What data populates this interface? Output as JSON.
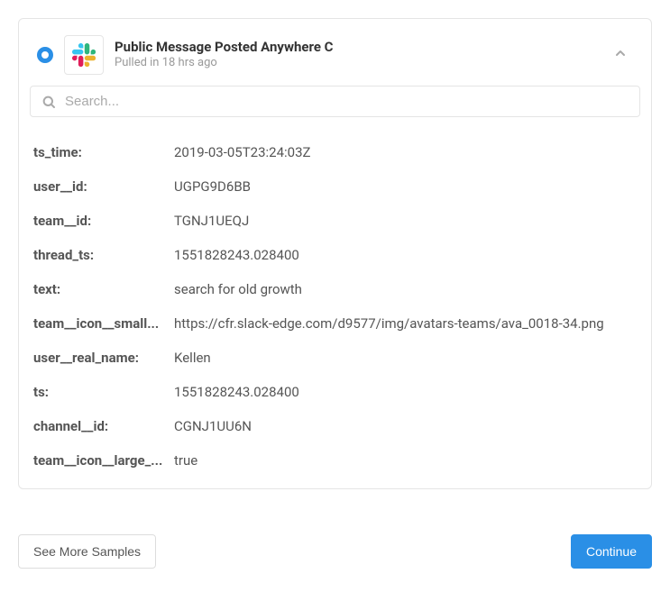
{
  "header": {
    "title": "Public Message Posted Anywhere C",
    "subtitle": "Pulled in 18 hrs ago"
  },
  "search": {
    "placeholder": "Search..."
  },
  "fields": [
    {
      "key": "ts_time:",
      "value": "2019-03-05T23:24:03Z"
    },
    {
      "key": "user__id:",
      "value": "UGPG9D6BB"
    },
    {
      "key": "team__id:",
      "value": "TGNJ1UEQJ"
    },
    {
      "key": "thread_ts:",
      "value": "1551828243.028400"
    },
    {
      "key": "text:",
      "value": "search for old growth"
    },
    {
      "key": "team__icon__small...",
      "value": "https://cfr.slack-edge.com/d9577/img/avatars-teams/ava_0018-34.png"
    },
    {
      "key": "user__real_name:",
      "value": "Kellen"
    },
    {
      "key": "ts:",
      "value": "1551828243.028400"
    },
    {
      "key": "channel__id:",
      "value": "CGNJ1UU6N"
    },
    {
      "key": "team__icon__large_...",
      "value": "true"
    }
  ],
  "footer": {
    "see_more": "See More Samples",
    "continue": "Continue"
  }
}
